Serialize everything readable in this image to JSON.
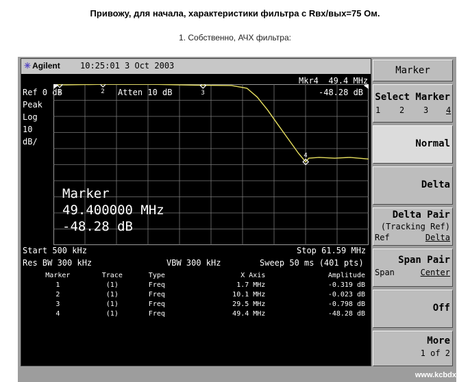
{
  "page": {
    "heading": "Привожу, для начала, характеристики фильтра с Rвх/вых=75 Ом.",
    "subheading": "1. Собственно, АЧХ фильтра:"
  },
  "screen": {
    "brand": "Agilent",
    "time": "10:25:01  3 Oct 2003",
    "ref_level": "Ref 0 dB",
    "atten": "Atten 10 dB",
    "mkr_label": "Mkr4  49.4 MHz",
    "mkr_value": "-48.28 dB",
    "detector": "Peak",
    "scale_type": "Log",
    "scale_value": "10",
    "scale_unit": "dB/",
    "marker_title": "Marker",
    "marker_freq": "49.400000 MHz",
    "marker_ampl": "-48.28 dB",
    "start": "Start 500 kHz",
    "stop": "Stop 61.59 MHz",
    "res_bw": "Res BW 300 kHz",
    "vbw": "VBW 300 kHz",
    "sweep": "Sweep 50 ms (401 pts)",
    "watermark": "www.kcbdx.ru"
  },
  "marker_table": {
    "headers": [
      "Marker",
      "Trace",
      "Type",
      "X Axis",
      "Amplitude"
    ],
    "rows": [
      [
        "1",
        "(1)",
        "Freq",
        "1.7 MHz",
        "-0.319 dB"
      ],
      [
        "2",
        "(1)",
        "Freq",
        "10.1 MHz",
        "-0.023 dB"
      ],
      [
        "3",
        "(1)",
        "Freq",
        "29.5 MHz",
        "-0.798 dB"
      ],
      [
        "4",
        "(1)",
        "Freq",
        "49.4 MHz",
        "-48.28 dB"
      ]
    ]
  },
  "softkeys": {
    "title": "Marker",
    "select_marker": "Select Marker",
    "select_numbers": [
      "1",
      "2",
      "3",
      "4"
    ],
    "normal": "Normal",
    "delta": "Delta",
    "delta_pair": "Delta Pair",
    "tracking_ref": "(Tracking Ref)",
    "ref": "Ref",
    "delta_sub": "Delta",
    "span_pair": "Span Pair",
    "span": "Span",
    "center": "Center",
    "off": "Off",
    "more": "More",
    "page": "1 of 2"
  },
  "chart_data": {
    "type": "line",
    "x_unit": "MHz",
    "y_unit": "dB",
    "xlim": [
      0.5,
      61.59
    ],
    "ylim": [
      -100,
      0
    ],
    "grid": true,
    "trace_color": "#e8e060",
    "x": [
      0.5,
      3,
      10,
      20,
      28,
      35,
      38,
      40,
      42,
      44,
      46,
      48,
      49.4,
      50,
      52,
      55,
      58,
      61.59
    ],
    "y": [
      -0.3,
      -0.4,
      -0.1,
      -0.1,
      -0.6,
      -0.8,
      -2.5,
      -8,
      -16,
      -25,
      -34,
      -43,
      -48.28,
      -46,
      -45.5,
      -46,
      -45.5,
      -46.5
    ],
    "markers": [
      {
        "label": "1",
        "x": 1.7,
        "y": -0.319
      },
      {
        "label": "2",
        "x": 10.1,
        "y": -0.023
      },
      {
        "label": "3",
        "x": 29.5,
        "y": -0.798
      },
      {
        "label": "4",
        "x": 49.4,
        "y": -48.28
      }
    ]
  }
}
